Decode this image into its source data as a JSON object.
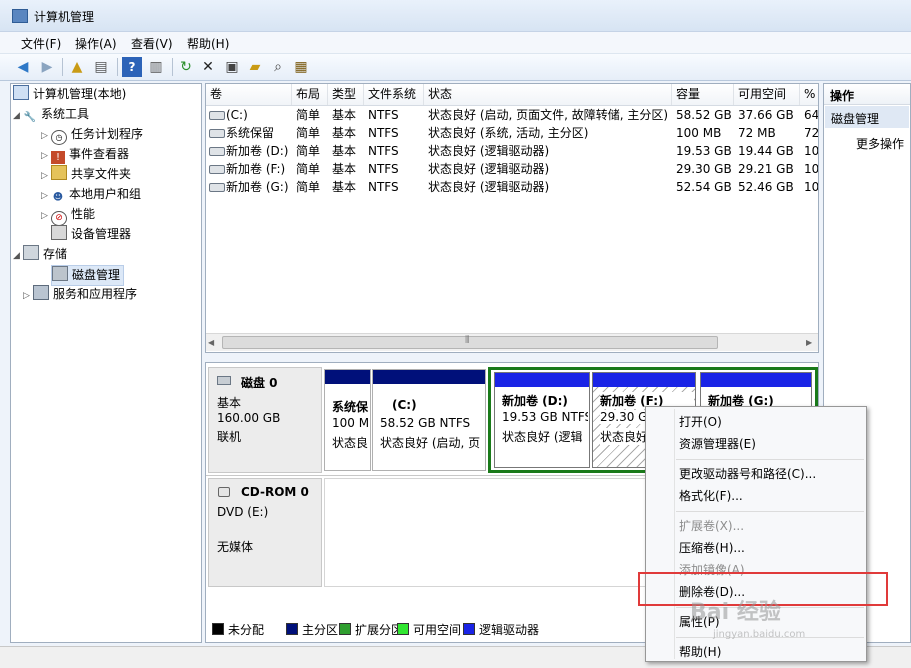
{
  "window": {
    "title": "计算机管理"
  },
  "menu": [
    "文件(F)",
    "操作(A)",
    "查看(V)",
    "帮助(H)"
  ],
  "toolbar": [
    "back-icon",
    "forward-icon",
    "up-icon",
    "console-tree-icon",
    "help-icon",
    "action-pane-icon",
    "refresh-icon",
    "delete-icon",
    "properties-icon",
    "open-icon",
    "find-icon",
    "settings-icon"
  ],
  "tree": [
    {
      "label": "计算机管理(本地)"
    },
    {
      "label": "系统工具"
    },
    {
      "label": "任务计划程序"
    },
    {
      "label": "事件查看器"
    },
    {
      "label": "共享文件夹"
    },
    {
      "label": "本地用户和组"
    },
    {
      "label": "性能"
    },
    {
      "label": "设备管理器"
    },
    {
      "label": "存储"
    },
    {
      "label": "磁盘管理"
    },
    {
      "label": "服务和应用程序"
    }
  ],
  "volume_columns": [
    "卷",
    "布局",
    "类型",
    "文件系统",
    "状态",
    "容量",
    "可用空间",
    "%"
  ],
  "volumes": [
    {
      "name": "(C:)",
      "layout": "简单",
      "type": "基本",
      "fs": "NTFS",
      "status": "状态良好 (启动, 页面文件, 故障转储, 主分区)",
      "capacity": "58.52 GB",
      "free": "37.66 GB",
      "pct": "64"
    },
    {
      "name": "系统保留",
      "layout": "简单",
      "type": "基本",
      "fs": "NTFS",
      "status": "状态良好 (系统, 活动, 主分区)",
      "capacity": "100 MB",
      "free": "72 MB",
      "pct": "72"
    },
    {
      "name": "新加卷 (D:)",
      "layout": "简单",
      "type": "基本",
      "fs": "NTFS",
      "status": "状态良好 (逻辑驱动器)",
      "capacity": "19.53 GB",
      "free": "19.44 GB",
      "pct": "10"
    },
    {
      "name": "新加卷 (F:)",
      "layout": "简单",
      "type": "基本",
      "fs": "NTFS",
      "status": "状态良好 (逻辑驱动器)",
      "capacity": "29.30 GB",
      "free": "29.21 GB",
      "pct": "10"
    },
    {
      "name": "新加卷 (G:)",
      "layout": "简单",
      "type": "基本",
      "fs": "NTFS",
      "status": "状态良好 (逻辑驱动器)",
      "capacity": "52.54 GB",
      "free": "52.46 GB",
      "pct": "10"
    }
  ],
  "disk0": {
    "name": "磁盘 0",
    "kind": "基本",
    "size": "160.00 GB",
    "state": "联机"
  },
  "partitions": [
    {
      "title": "系统保",
      "line2": "100 M",
      "line3": "状态良"
    },
    {
      "title": "(C:)",
      "line2": "58.52 GB NTFS",
      "line3": "状态良好 (启动, 页"
    },
    {
      "title": "新加卷  (D:)",
      "line2": "19.53 GB NTFS",
      "line3": "状态良好 (逻辑"
    },
    {
      "title": "新加卷  (F:)",
      "line2": "29.30 G",
      "line3": "状态良好"
    },
    {
      "title": "新加卷  (G:)",
      "line2": "",
      "line3": ""
    }
  ],
  "cdrom": {
    "name": "CD-ROM 0",
    "drive": "DVD (E:)",
    "media": "无媒体"
  },
  "legend": [
    {
      "label": "未分配",
      "color": "#000000"
    },
    {
      "label": "主分区",
      "color": "#00107a"
    },
    {
      "label": "扩展分区",
      "color": "#2f9e2f"
    },
    {
      "label": "可用空间",
      "color": "#31e631"
    },
    {
      "label": "逻辑驱动器",
      "color": "#1a24e6"
    }
  ],
  "actions": {
    "header": "操作",
    "section": "磁盘管理",
    "more": "更多操作"
  },
  "context_menu": [
    {
      "label": "打开(O)",
      "enabled": true
    },
    {
      "label": "资源管理器(E)",
      "enabled": true
    },
    {
      "label": "更改驱动器号和路径(C)...",
      "enabled": true
    },
    {
      "label": "格式化(F)...",
      "enabled": true
    },
    {
      "label": "扩展卷(X)...",
      "enabled": false
    },
    {
      "label": "压缩卷(H)...",
      "enabled": true
    },
    {
      "label": "添加镜像(A)...",
      "enabled": false
    },
    {
      "label": "删除卷(D)...",
      "enabled": true
    },
    {
      "label": "属性(P)",
      "enabled": true
    },
    {
      "label": "帮助(H)",
      "enabled": true
    }
  ],
  "watermark": {
    "main": "Bai 经验",
    "sub": "jingyan.baidu.com"
  }
}
